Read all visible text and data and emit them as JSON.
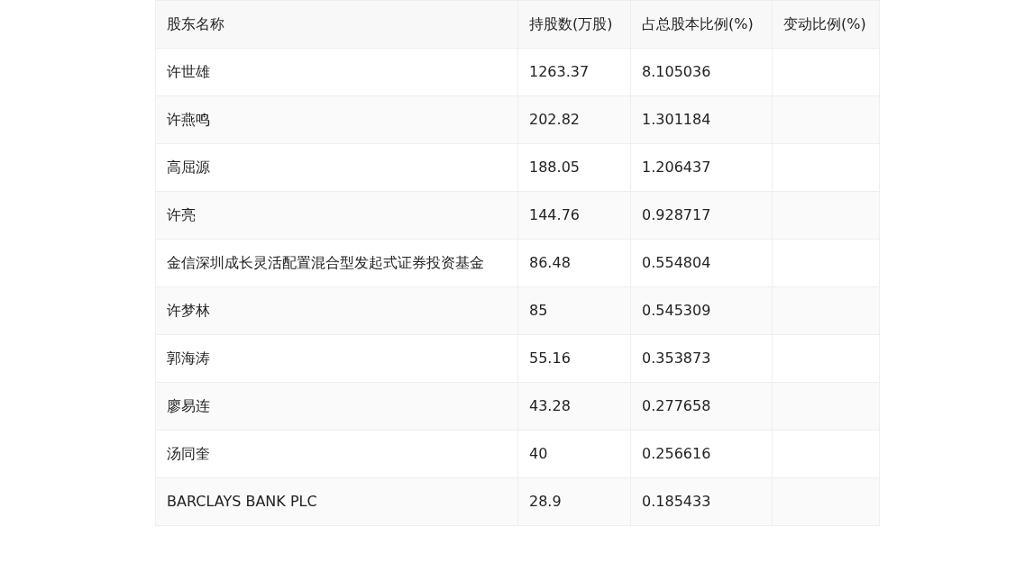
{
  "table": {
    "columns": [
      "股东名称",
      "持股数(万股)",
      "占总股本比例(%)",
      "变动比例(%)"
    ],
    "rows": [
      [
        "许世雄",
        "1263.37",
        "8.105036",
        ""
      ],
      [
        "许燕鸣",
        "202.82",
        "1.301184",
        ""
      ],
      [
        "高屈源",
        "188.05",
        "1.206437",
        ""
      ],
      [
        "许亮",
        "144.76",
        "0.928717",
        ""
      ],
      [
        "金信深圳成长灵活配置混合型发起式证券投资基金",
        "86.48",
        "0.554804",
        ""
      ],
      [
        "许梦林",
        "85",
        "0.545309",
        ""
      ],
      [
        "郭海涛",
        "55.16",
        "0.353873",
        ""
      ],
      [
        "廖易连",
        "43.28",
        "0.277658",
        ""
      ],
      [
        "汤同奎",
        "40",
        "0.256616",
        ""
      ],
      [
        "BARCLAYS BANK PLC",
        "28.9",
        "0.185433",
        ""
      ]
    ]
  }
}
